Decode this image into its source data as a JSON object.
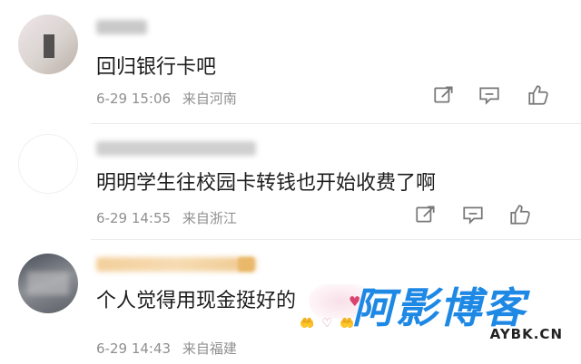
{
  "comments": [
    {
      "text": "回归银行卡吧",
      "date": "6-29",
      "time": "15:06",
      "location": "来自河南",
      "actions": [
        "share-icon",
        "reply-icon",
        "like-icon"
      ]
    },
    {
      "text": "明明学生往校园卡转钱也开始收费了啊",
      "date": "6-29",
      "time": "14:55",
      "location": "来自浙江",
      "actions": [
        "share-icon",
        "reply-icon",
        "like-icon"
      ]
    },
    {
      "text": "个人觉得用现金挺好的",
      "date": "6-29",
      "time": "14:43",
      "location": "来自福建",
      "sticker": "♥",
      "sticker_hands": "🤲 ♡ 🤲"
    }
  ],
  "watermark": {
    "logo": "阿影博客",
    "sub": "AYBK.CN"
  },
  "colors": {
    "meta_text": "#8f8f8f",
    "watermark_blue": "#1e88e5",
    "icon_stroke": "#777777"
  }
}
